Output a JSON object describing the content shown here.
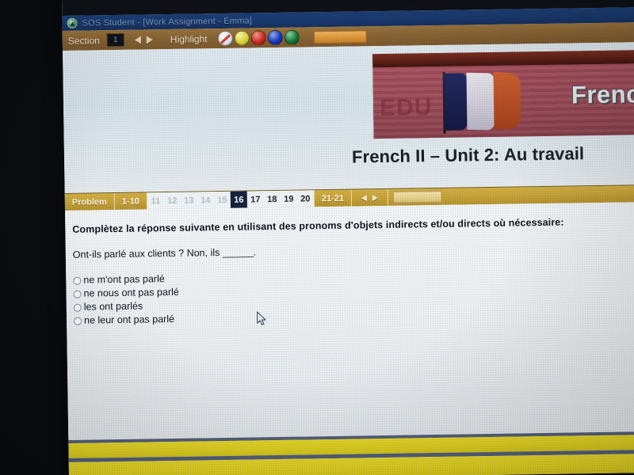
{
  "window": {
    "logo_icon": "sos-logo-icon",
    "title": "SOS Student - [Work Assignment - Emma]"
  },
  "toolbar": {
    "section_label": "Section",
    "section_value": "1",
    "prev_icon": "triangle-left-icon",
    "next_icon": "triangle-right-icon",
    "highlight_label": "Highlight",
    "swatches": [
      {
        "name": "no-highlight",
        "color": "#ffffff"
      },
      {
        "name": "yellow-highlight",
        "color": "#ddd641"
      },
      {
        "name": "red-highlight",
        "color": "#cf2b23"
      },
      {
        "name": "blue-highlight",
        "color": "#1a39c6"
      },
      {
        "name": "green-highlight",
        "color": "#147a3a"
      }
    ],
    "action_button_label": ""
  },
  "banner": {
    "word": "French",
    "wall_ghost_text": "EDU",
    "course_title": "French II – Unit 2: Au travail"
  },
  "problem_bar": {
    "label": "Problem",
    "range_start": "1-10",
    "numbers": [
      {
        "value": "11",
        "state": "dim"
      },
      {
        "value": "12",
        "state": "dim"
      },
      {
        "value": "13",
        "state": "dim"
      },
      {
        "value": "14",
        "state": "dim"
      },
      {
        "value": "15",
        "state": "dim"
      },
      {
        "value": "16",
        "state": "selected"
      },
      {
        "value": "17",
        "state": "normal"
      },
      {
        "value": "18",
        "state": "normal"
      },
      {
        "value": "19",
        "state": "normal"
      },
      {
        "value": "20",
        "state": "normal"
      }
    ],
    "range_end": "21-21",
    "prev_icon": "triangle-left-icon",
    "next_icon": "triangle-right-icon",
    "action_button_label": ""
  },
  "question": {
    "prompt": "Complètez la réponse suivante en utilisant des pronoms d'objets indirects et/ou directs où nécessaire:",
    "sentence_before": "Ont-ils parlé aux clients ? Non, ils ",
    "blank": "______",
    "sentence_after": ".",
    "options": [
      {
        "label": "ne m'ont pas parlé",
        "selected": false
      },
      {
        "label": "ne nous ont pas parlé",
        "selected": false
      },
      {
        "label": "les ont parlés",
        "selected": false
      },
      {
        "label": "ne leur ont pas parlé",
        "selected": false
      }
    ]
  },
  "colors": {
    "titlebar": "#1a3a70",
    "toolbar": "#8a6534",
    "problem_bar": "#c9a53a",
    "selected_problem": "#16233e",
    "bottom_band": "#e3d422",
    "content_bg": "#eef2f5"
  },
  "cursor": {
    "icon": "mouse-pointer-icon"
  }
}
